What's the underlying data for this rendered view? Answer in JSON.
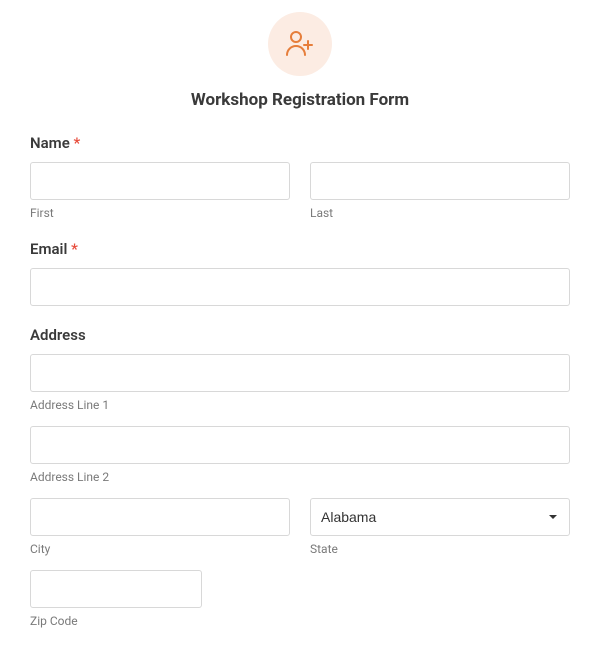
{
  "title": "Workshop Registration Form",
  "fields": {
    "name": {
      "label": "Name",
      "required": "*",
      "first": "First",
      "last": "Last"
    },
    "email": {
      "label": "Email",
      "required": "*"
    },
    "address": {
      "label": "Address",
      "line1": "Address Line 1",
      "line2": "Address Line 2",
      "city": "City",
      "state": "State",
      "zip": "Zip Code",
      "state_value": "Alabama"
    }
  }
}
